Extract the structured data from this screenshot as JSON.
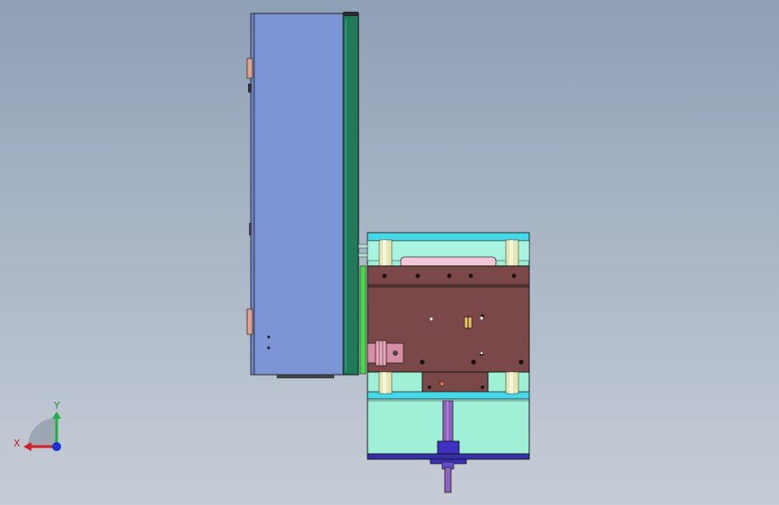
{
  "viewport": {
    "background_top": "#8ea0b6",
    "background_bottom": "#c6cdd6"
  },
  "triad": {
    "x_label": "X",
    "y_label": "Y",
    "x_color": "#d42020",
    "y_color": "#20b040",
    "z_color": "#1a2fd0"
  },
  "model": {
    "colors": {
      "cabinet_body": "#7b95d6",
      "cabinet_door": "#207a5a",
      "mold_frame": "#a0f0d8",
      "cyan_plate": "#45d8e8",
      "brown_plate": "#7a4848",
      "lime_strip": "#40e040",
      "pink_cylinder": "#d98ca6",
      "screw_blue": "#4030c0",
      "screw_purple": "#9060c0",
      "bottom_bar": "#3430a8",
      "guide_pillar": "#e6e6b0"
    }
  }
}
